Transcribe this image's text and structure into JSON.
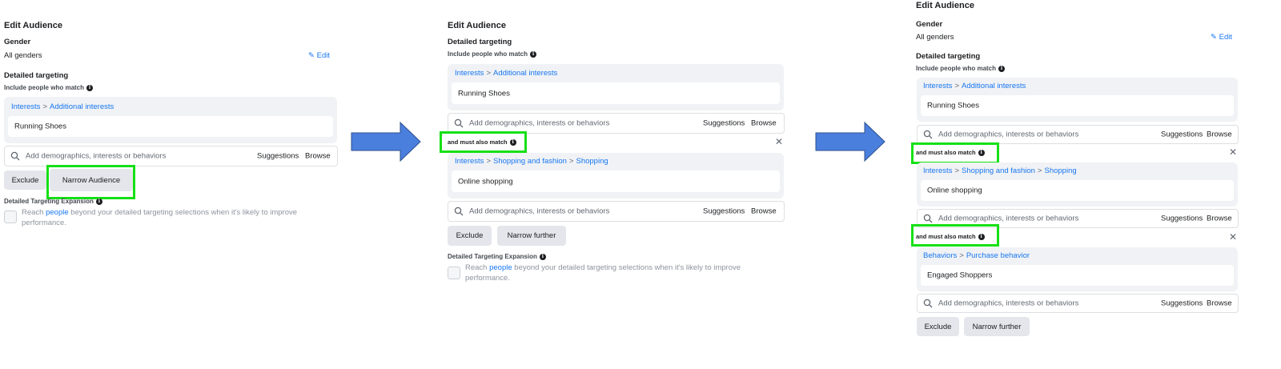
{
  "colors": {
    "accent": "#1877f2",
    "highlight": "#16e016",
    "arrow": "#4a7fde"
  },
  "panel1": {
    "title": "Edit Audience",
    "gender_label": "Gender",
    "gender_value": "All genders",
    "edit_label": "Edit",
    "detailed_label": "Detailed targeting",
    "include_label": "Include people who match",
    "group1": {
      "crumb1": "Interests",
      "sep": ">",
      "crumb2": "Additional interests",
      "value": "Running Shoes"
    },
    "search": {
      "placeholder": "Add demographics, interests or behaviors",
      "suggestions": "Suggestions",
      "browse": "Browse"
    },
    "exclude_label": "Exclude",
    "narrow_label": "Narrow Audience",
    "expansion_label": "Detailed Targeting Expansion",
    "expansion_text1": "Reach",
    "expansion_link": "people",
    "expansion_text2": "beyond your detailed targeting selections when it's likely to improve",
    "expansion_text3": "performance."
  },
  "panel2": {
    "title": "Edit Audience",
    "detailed_label": "Detailed targeting",
    "include_label": "Include people who match",
    "group1": {
      "crumb1": "Interests",
      "sep": ">",
      "crumb2": "Additional interests",
      "value": "Running Shoes"
    },
    "match_label": "and must also match",
    "group2": {
      "crumb1": "Interests",
      "sep1": ">",
      "crumb2": "Shopping and fashion",
      "sep2": ">",
      "crumb3": "Shopping",
      "value": "Online shopping"
    },
    "search": {
      "placeholder": "Add demographics, interests or behaviors",
      "suggestions": "Suggestions",
      "browse": "Browse"
    },
    "exclude_label": "Exclude",
    "narrow_label": "Narrow further",
    "expansion_label": "Detailed Targeting Expansion",
    "expansion_text1": "Reach",
    "expansion_link": "people",
    "expansion_text2": "beyond your detailed targeting selections when it's likely to improve",
    "expansion_text3": "performance."
  },
  "panel3": {
    "title": "Edit Audience",
    "gender_label": "Gender",
    "gender_value": "All genders",
    "edit_label": "Edit",
    "detailed_label": "Detailed targeting",
    "include_label": "Include people who match",
    "group1": {
      "crumb1": "Interests",
      "sep": ">",
      "crumb2": "Additional interests",
      "value": "Running Shoes"
    },
    "match_label": "and must also match",
    "group2": {
      "crumb1": "Interests",
      "sep1": ">",
      "crumb2": "Shopping and fashion",
      "sep2": ">",
      "crumb3": "Shopping",
      "value": "Online shopping"
    },
    "group3": {
      "crumb1": "Behaviors",
      "sep": ">",
      "crumb2": "Purchase behavior",
      "value": "Engaged Shoppers"
    },
    "search": {
      "placeholder": "Add demographics, interests or behaviors",
      "suggestions": "Suggestions",
      "browse": "Browse"
    },
    "exclude_label": "Exclude",
    "narrow_label": "Narrow further"
  },
  "icons": {
    "info": "i",
    "close": "✕",
    "pencil": "✎"
  }
}
